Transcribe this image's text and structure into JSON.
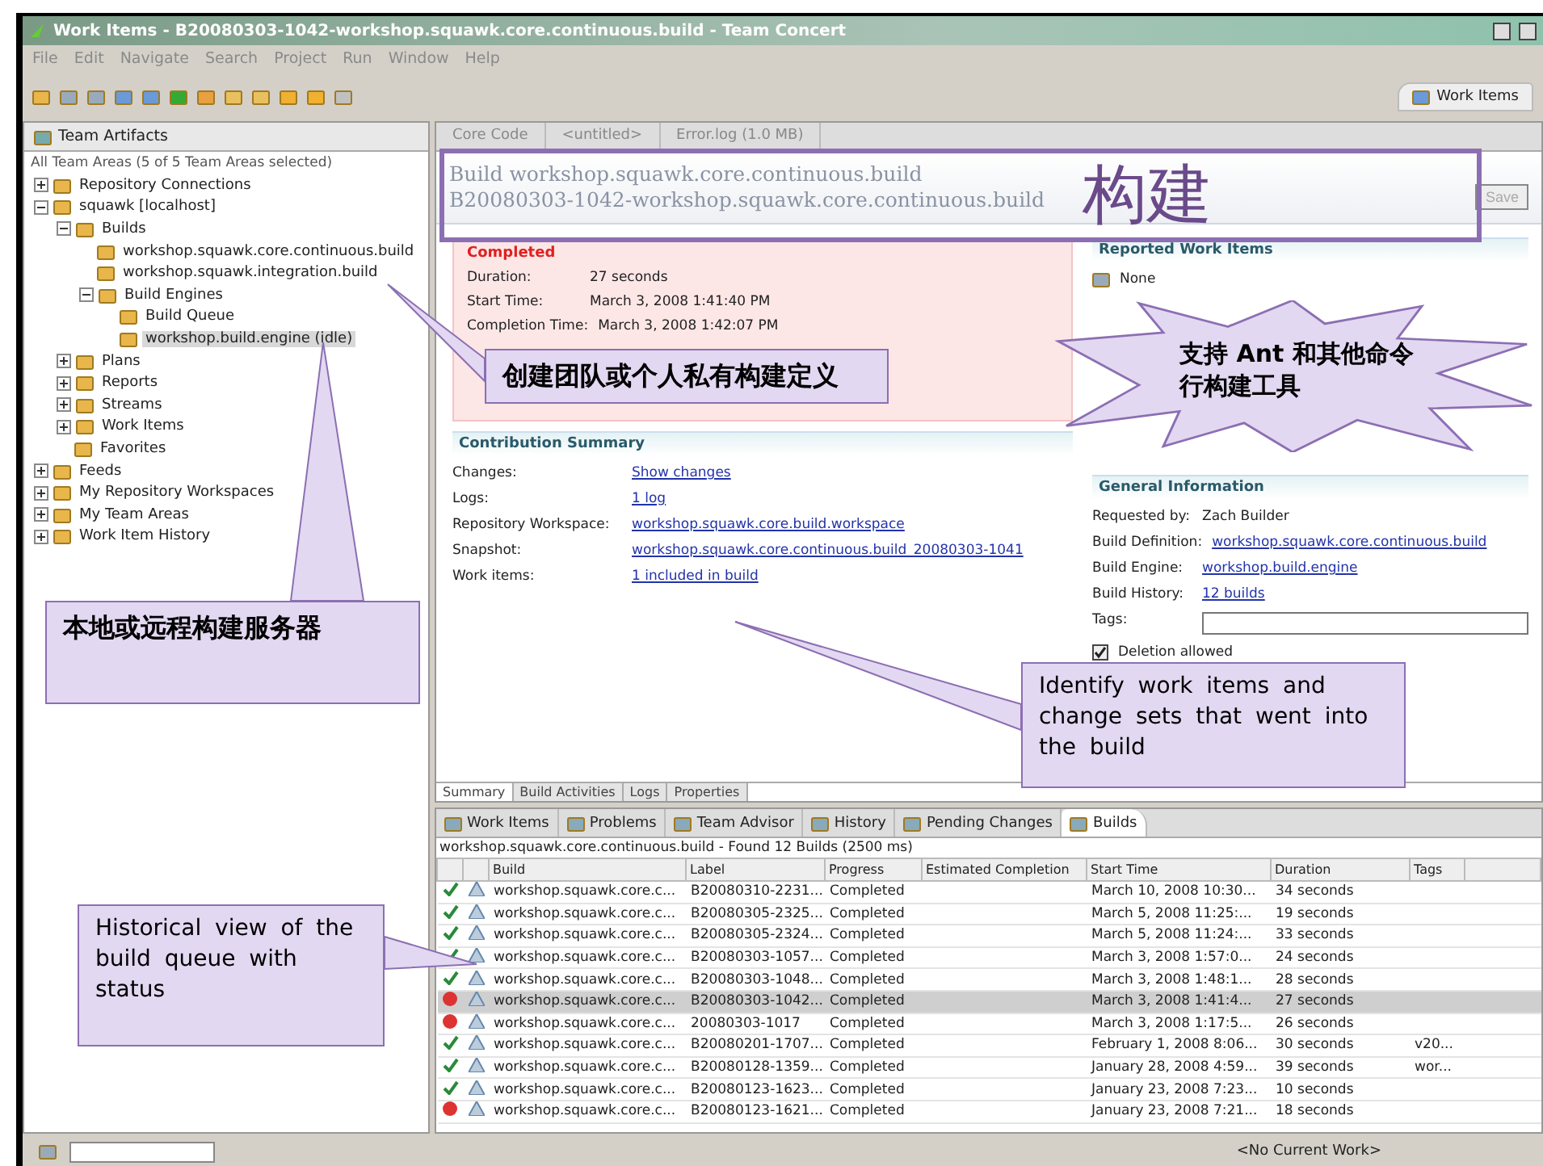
{
  "window": {
    "title": "Work Items - B20080303-1042-workshop.squawk.core.continuous.build - Team Concert"
  },
  "menu": [
    "File",
    "Edit",
    "Navigate",
    "Search",
    "Project",
    "Run",
    "Window",
    "Help"
  ],
  "perspective": {
    "label": "Work Items"
  },
  "team_artifacts": {
    "tab": "Team Artifacts",
    "filter": "All Team Areas (5 of 5 Team Areas selected)",
    "tree": [
      {
        "label": "Repository Connections",
        "expanded": false,
        "selected": false
      },
      {
        "label": "squawk [localhost]",
        "expanded": true,
        "selected": false,
        "children": [
          {
            "label": "Builds",
            "expanded": true,
            "selected": false,
            "children": [
              {
                "label": "workshop.squawk.core.continuous.build",
                "selected": false
              },
              {
                "label": "workshop.squawk.integration.build",
                "selected": false
              },
              {
                "label": "Build Engines",
                "expanded": true,
                "selected": false,
                "children": [
                  {
                    "label": "Build Queue",
                    "selected": false
                  },
                  {
                    "label": "workshop.build.engine (idle)",
                    "selected": true
                  }
                ]
              }
            ]
          },
          {
            "label": "Plans",
            "expanded": false,
            "selected": false
          },
          {
            "label": "Reports",
            "expanded": false,
            "selected": false
          },
          {
            "label": "Streams",
            "expanded": false,
            "selected": false
          },
          {
            "label": "Work Items",
            "expanded": false,
            "selected": false
          },
          {
            "label": "Favorites",
            "selected": false
          }
        ]
      },
      {
        "label": "Feeds",
        "expanded": false,
        "selected": false
      },
      {
        "label": "My Repository Workspaces",
        "expanded": false,
        "selected": false
      },
      {
        "label": "My Team Areas",
        "expanded": false,
        "selected": false
      },
      {
        "label": "Work Item History",
        "expanded": false,
        "selected": false
      }
    ]
  },
  "editor_tabs": [
    "Core Code",
    "<untitled>",
    "Error.log (1.0 MB)"
  ],
  "editor": {
    "title": "Build workshop.squawk.core.continuous.build",
    "subtitle": "B20080303-1042-workshop.squawk.core.continuous.build",
    "save": {
      "label": "Save",
      "disabled": true
    },
    "result": {
      "label": "Completed",
      "failed": true,
      "fields": [
        {
          "label": "Duration:",
          "value": "27 seconds"
        },
        {
          "label": "Start Time:",
          "value": "March 3, 2008 1:41:40 PM"
        },
        {
          "label": "Completion Time:",
          "value": "March 3, 2008 1:42:07 PM"
        }
      ]
    },
    "contribution": {
      "heading": "Contribution Summary",
      "rows": [
        {
          "label": "Changes:",
          "link": "Show changes"
        },
        {
          "label": "Logs:",
          "link": "1 log"
        },
        {
          "label": "Repository Workspace:",
          "link": "workshop.squawk.core.build.workspace"
        },
        {
          "label": "Snapshot:",
          "link": "workshop.squawk.core.continuous.build_20080303-1041"
        },
        {
          "label": "Work items:",
          "link": "1 included in build"
        }
      ]
    },
    "reported": {
      "heading": "Reported Work Items",
      "items": [
        "None"
      ]
    },
    "general": {
      "heading": "General Information",
      "rows": [
        {
          "kind": "text",
          "label": "Requested by:",
          "value": "Zach Builder"
        },
        {
          "kind": "link",
          "label": "Build Definition:",
          "value": "workshop.squawk.core.continuous.build"
        },
        {
          "kind": "link",
          "label": "Build Engine:",
          "value": "workshop.build.engine"
        },
        {
          "kind": "link",
          "label": "Build History:",
          "value": "12 builds"
        },
        {
          "kind": "field",
          "label": "Tags:"
        }
      ],
      "deletion": {
        "label": "Deletion allowed",
        "checked": true
      }
    },
    "pages": [
      {
        "label": "Summary",
        "selected": true
      },
      {
        "label": "Build Activities",
        "selected": false
      },
      {
        "label": "Logs",
        "selected": false
      },
      {
        "label": "Properties",
        "selected": false
      }
    ]
  },
  "views": [
    {
      "label": "Work Items",
      "selected": false
    },
    {
      "label": "Problems",
      "selected": false
    },
    {
      "label": "Team Advisor",
      "selected": false
    },
    {
      "label": "History",
      "selected": false
    },
    {
      "label": "Pending Changes",
      "selected": false
    },
    {
      "label": "Builds",
      "selected": true
    }
  ],
  "builds": {
    "summary": "workshop.squawk.core.continuous.build - Found 12 Builds (2500 ms)",
    "columns": [
      "Build",
      "Label",
      "Progress",
      "Estimated Completion",
      "Start Time",
      "Duration",
      "Tags"
    ],
    "rows": [
      {
        "failed": false,
        "selected": false,
        "cells": [
          "workshop.squawk.core.c...",
          "B20080310-2231...",
          "Completed",
          "",
          "March 10, 2008 10:30...",
          "34 seconds",
          ""
        ]
      },
      {
        "failed": false,
        "selected": false,
        "cells": [
          "workshop.squawk.core.c...",
          "B20080305-2325...",
          "Completed",
          "",
          "March 5, 2008 11:25:...",
          "19 seconds",
          ""
        ]
      },
      {
        "failed": false,
        "selected": false,
        "cells": [
          "workshop.squawk.core.c...",
          "B20080305-2324...",
          "Completed",
          "",
          "March 5, 2008 11:24:...",
          "33 seconds",
          ""
        ]
      },
      {
        "failed": false,
        "selected": false,
        "cells": [
          "workshop.squawk.core.c...",
          "B20080303-1057...",
          "Completed",
          "",
          "March 3, 2008 1:57:0...",
          "24 seconds",
          ""
        ]
      },
      {
        "failed": false,
        "selected": false,
        "cells": [
          "workshop.squawk.core.c...",
          "B20080303-1048...",
          "Completed",
          "",
          "March 3, 2008 1:48:1...",
          "28 seconds",
          ""
        ]
      },
      {
        "failed": true,
        "selected": true,
        "cells": [
          "workshop.squawk.core.c...",
          "B20080303-1042...",
          "Completed",
          "",
          "March 3, 2008 1:41:4...",
          "27 seconds",
          ""
        ]
      },
      {
        "failed": true,
        "selected": false,
        "cells": [
          "workshop.squawk.core.c...",
          "20080303-1017",
          "Completed",
          "",
          "March 3, 2008 1:17:5...",
          "26 seconds",
          ""
        ]
      },
      {
        "failed": false,
        "selected": false,
        "cells": [
          "workshop.squawk.core.c...",
          "B20080201-1707...",
          "Completed",
          "",
          "February 1, 2008 8:06...",
          "30 seconds",
          "v20..."
        ]
      },
      {
        "failed": false,
        "selected": false,
        "cells": [
          "workshop.squawk.core.c...",
          "B20080128-1359...",
          "Completed",
          "",
          "January 28, 2008 4:59...",
          "39 seconds",
          "wor..."
        ]
      },
      {
        "failed": false,
        "selected": false,
        "cells": [
          "workshop.squawk.core.c...",
          "B20080123-1623...",
          "Completed",
          "",
          "January 23, 2008 7:23...",
          "10 seconds",
          ""
        ]
      },
      {
        "failed": true,
        "selected": false,
        "cells": [
          "workshop.squawk.core.c...",
          "B20080123-1621...",
          "Completed",
          "",
          "January 23, 2008 7:21...",
          "18 seconds",
          ""
        ]
      }
    ]
  },
  "status_bar": {
    "work": "<No Current Work>"
  },
  "callouts": [
    {
      "kind": "frame",
      "text": "构建"
    },
    {
      "kind": "box",
      "text": "创建团队或个人私有构建定义"
    },
    {
      "kind": "burst",
      "text": "支持 Ant 和其他命令行构建工具"
    },
    {
      "kind": "box",
      "text": "本地或远程构建服务器"
    },
    {
      "kind": "box",
      "text": "Identify work items and change sets that went into the build"
    },
    {
      "kind": "box",
      "text": "Historical view of the build queue with status"
    }
  ]
}
